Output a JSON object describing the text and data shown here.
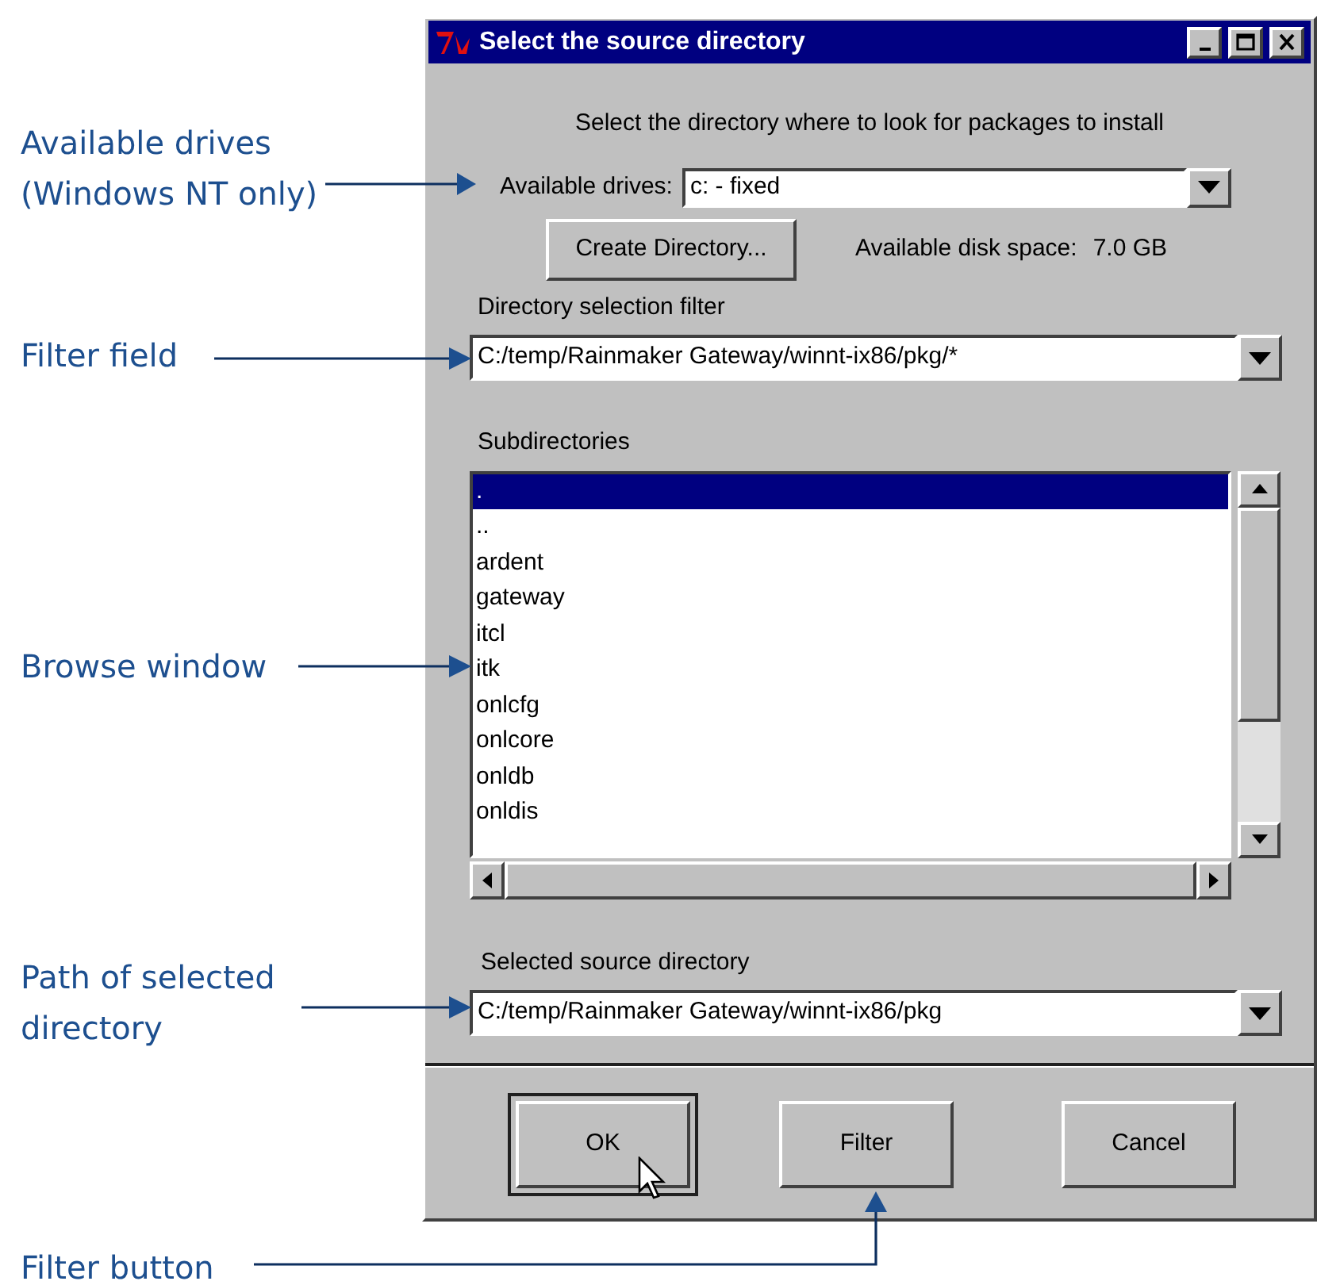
{
  "callouts": [
    {
      "lines": [
        "Available drives",
        "(Windows NT only)"
      ]
    },
    {
      "lines": [
        "Filter field"
      ]
    },
    {
      "lines": [
        "Browse window"
      ]
    },
    {
      "lines": [
        "Path of selected",
        "directory"
      ]
    },
    {
      "lines": [
        "Filter button"
      ]
    }
  ],
  "window": {
    "title": "Select the source directory",
    "prompt": "Select the directory where to look for packages to install",
    "drives": {
      "label": "Available drives:",
      "value": "c: - fixed"
    },
    "create_button": "Create Directory...",
    "disk_space": {
      "label": "Available disk space:",
      "value": "7.0 GB"
    },
    "filter": {
      "label": "Directory selection filter",
      "value": "C:/temp/Rainmaker Gateway/winnt-ix86/pkg/*"
    },
    "subdirectories": {
      "label": "Subdirectories",
      "items": [
        {
          "name": ".",
          "selected": true
        },
        {
          "name": "..",
          "selected": false
        },
        {
          "name": "ardent",
          "selected": false
        },
        {
          "name": "gateway",
          "selected": false
        },
        {
          "name": "itcl",
          "selected": false
        },
        {
          "name": "itk",
          "selected": false
        },
        {
          "name": "onlcfg",
          "selected": false
        },
        {
          "name": "onlcore",
          "selected": false
        },
        {
          "name": "onldb",
          "selected": false
        },
        {
          "name": "onldis",
          "selected": false
        }
      ]
    },
    "selected_directory": {
      "label": "Selected source directory",
      "value": "C:/temp/Rainmaker Gateway/winnt-ix86/pkg"
    },
    "buttons": [
      {
        "label": "OK",
        "default": true
      },
      {
        "label": "Filter",
        "default": false
      },
      {
        "label": "Cancel",
        "default": false
      }
    ]
  }
}
